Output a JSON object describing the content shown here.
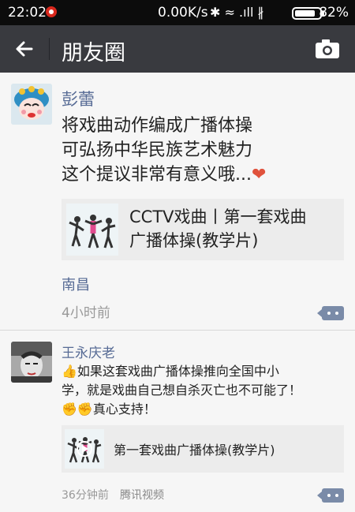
{
  "status_bar": {
    "time": "22:02",
    "network_speed": "0.00K/s",
    "icons": "✱ ≈ .ıll ∦",
    "battery_pct": "82%",
    "battery_level": 0.82
  },
  "header": {
    "title": "朋友圈"
  },
  "posts": [
    {
      "author": "彭蕾",
      "text_lines": [
        "将戏曲动作编成广播体操",
        "可弘扬中华民族艺术魅力",
        "这个提议非常有意义哦..."
      ],
      "heart": "❤",
      "link_title_lines": [
        "CCTV戏曲丨第一套戏曲",
        "广播体操(教学片)"
      ],
      "location": "南昌",
      "time": "4小时前"
    },
    {
      "author": "王永庆老",
      "text_lines": [
        "👍如果这套戏曲广播体操推向全国中小",
        "学，就是戏曲自己想自杀灭亡也不可能了！",
        "✊✊真心支持！"
      ],
      "link_title": "第一套戏曲广播体操(教学片)",
      "time": "36分钟前",
      "source": "腾讯视频"
    }
  ],
  "colors": {
    "titlebar": "#393a3f",
    "name_link": "#576b95",
    "heart": "#e0523c"
  }
}
